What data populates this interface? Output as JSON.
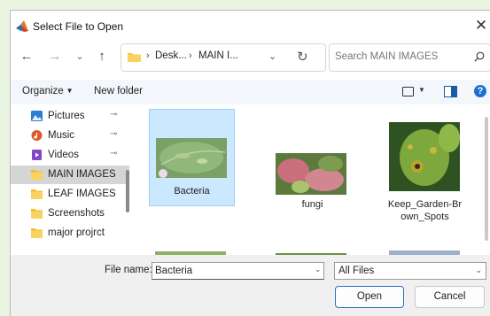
{
  "dialog": {
    "title": "Select File to Open",
    "close_symbol": "✕",
    "logo_icon": "matlab-logo-icon"
  },
  "nav": {
    "back_symbol": "←",
    "forward_symbol": "→",
    "recent_symbol": "⌄",
    "up_symbol": "↑",
    "breadcrumb_sep": "›",
    "breadcrumbs": [
      "Desk...",
      "MAIN I..."
    ],
    "dropdown_symbol": "⌄",
    "refresh_symbol": "↻"
  },
  "search": {
    "placeholder": "Search MAIN IMAGES"
  },
  "toolbar": {
    "organize_label": "Organize",
    "organize_caret": "▼",
    "new_folder_label": "New folder",
    "view_caret": "▼",
    "help_symbol": "?"
  },
  "sidebar": {
    "items": [
      {
        "label": "Pictures",
        "icon": "pictures-icon",
        "pinned": true
      },
      {
        "label": "Music",
        "icon": "music-icon",
        "pinned": true
      },
      {
        "label": "Videos",
        "icon": "videos-icon",
        "pinned": true
      },
      {
        "label": "MAIN IMAGES",
        "icon": "folder-icon",
        "selected": true
      },
      {
        "label": "LEAF IMAGES",
        "icon": "folder-icon"
      },
      {
        "label": "Screenshots",
        "icon": "folder-icon"
      },
      {
        "label": "major projrct",
        "icon": "folder-icon"
      }
    ],
    "pin_symbol": "📌"
  },
  "files": [
    {
      "name": "Bacteria",
      "selected": true
    },
    {
      "name": "fungi"
    },
    {
      "name": "Keep_Garden-Br own_Spots"
    }
  ],
  "footer": {
    "file_name_label": "File name:",
    "file_name_value": "Bacteria",
    "file_type_value": "All Files",
    "dropdown_symbol": "⌄",
    "open_label": "Open",
    "cancel_label": "Cancel"
  },
  "colors": {
    "accent": "#1b6fd0",
    "selection": "#cce8ff",
    "folder": "#f7c845",
    "background": "#eaf5e1"
  }
}
